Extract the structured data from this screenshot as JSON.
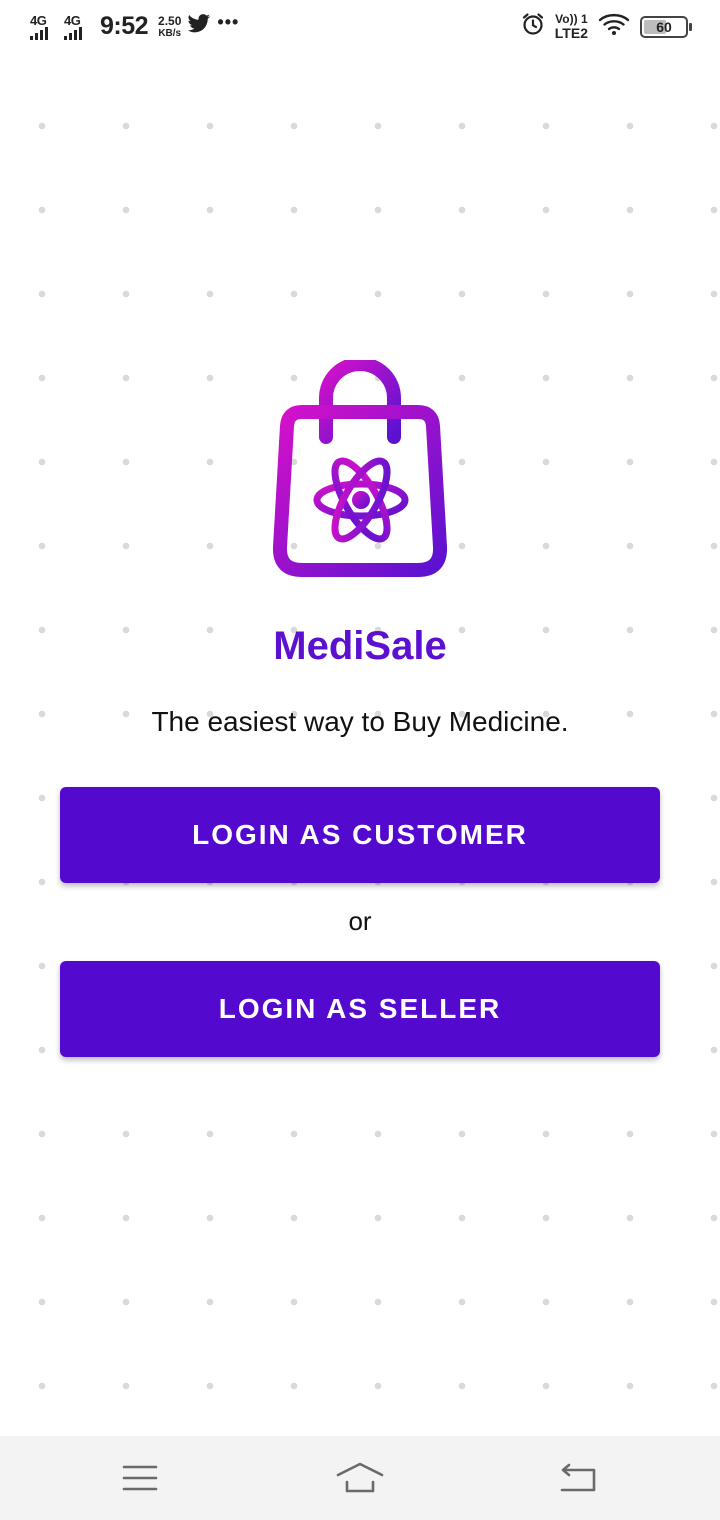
{
  "status_bar": {
    "signal1_label": "4G",
    "signal2_label": "4G",
    "time": "9:52",
    "net_speed_value": "2.50",
    "net_speed_unit": "KB/s",
    "notification_icons": [
      "twitter-icon",
      "more-icon"
    ],
    "more_text": "•••",
    "volte_line1": "Vo)) 1",
    "volte_line2": "LTE2",
    "battery_level": 60,
    "battery_text": "60"
  },
  "app": {
    "name": "MediSale",
    "tagline": "The easiest way to Buy Medicine.",
    "logo_icon": "shopping-bag-atom-icon",
    "colors": {
      "brand": "#5b11cf",
      "button": "#5409cf",
      "logo_gradient_start": "#d511c9",
      "logo_gradient_end": "#5a12d0"
    }
  },
  "buttons": {
    "customer_label": "LOGIN AS CUSTOMER",
    "separator": "or",
    "seller_label": "LOGIN AS SELLER"
  },
  "nav_bar": {
    "icons": [
      "menu-icon",
      "home-icon",
      "back-icon"
    ]
  }
}
